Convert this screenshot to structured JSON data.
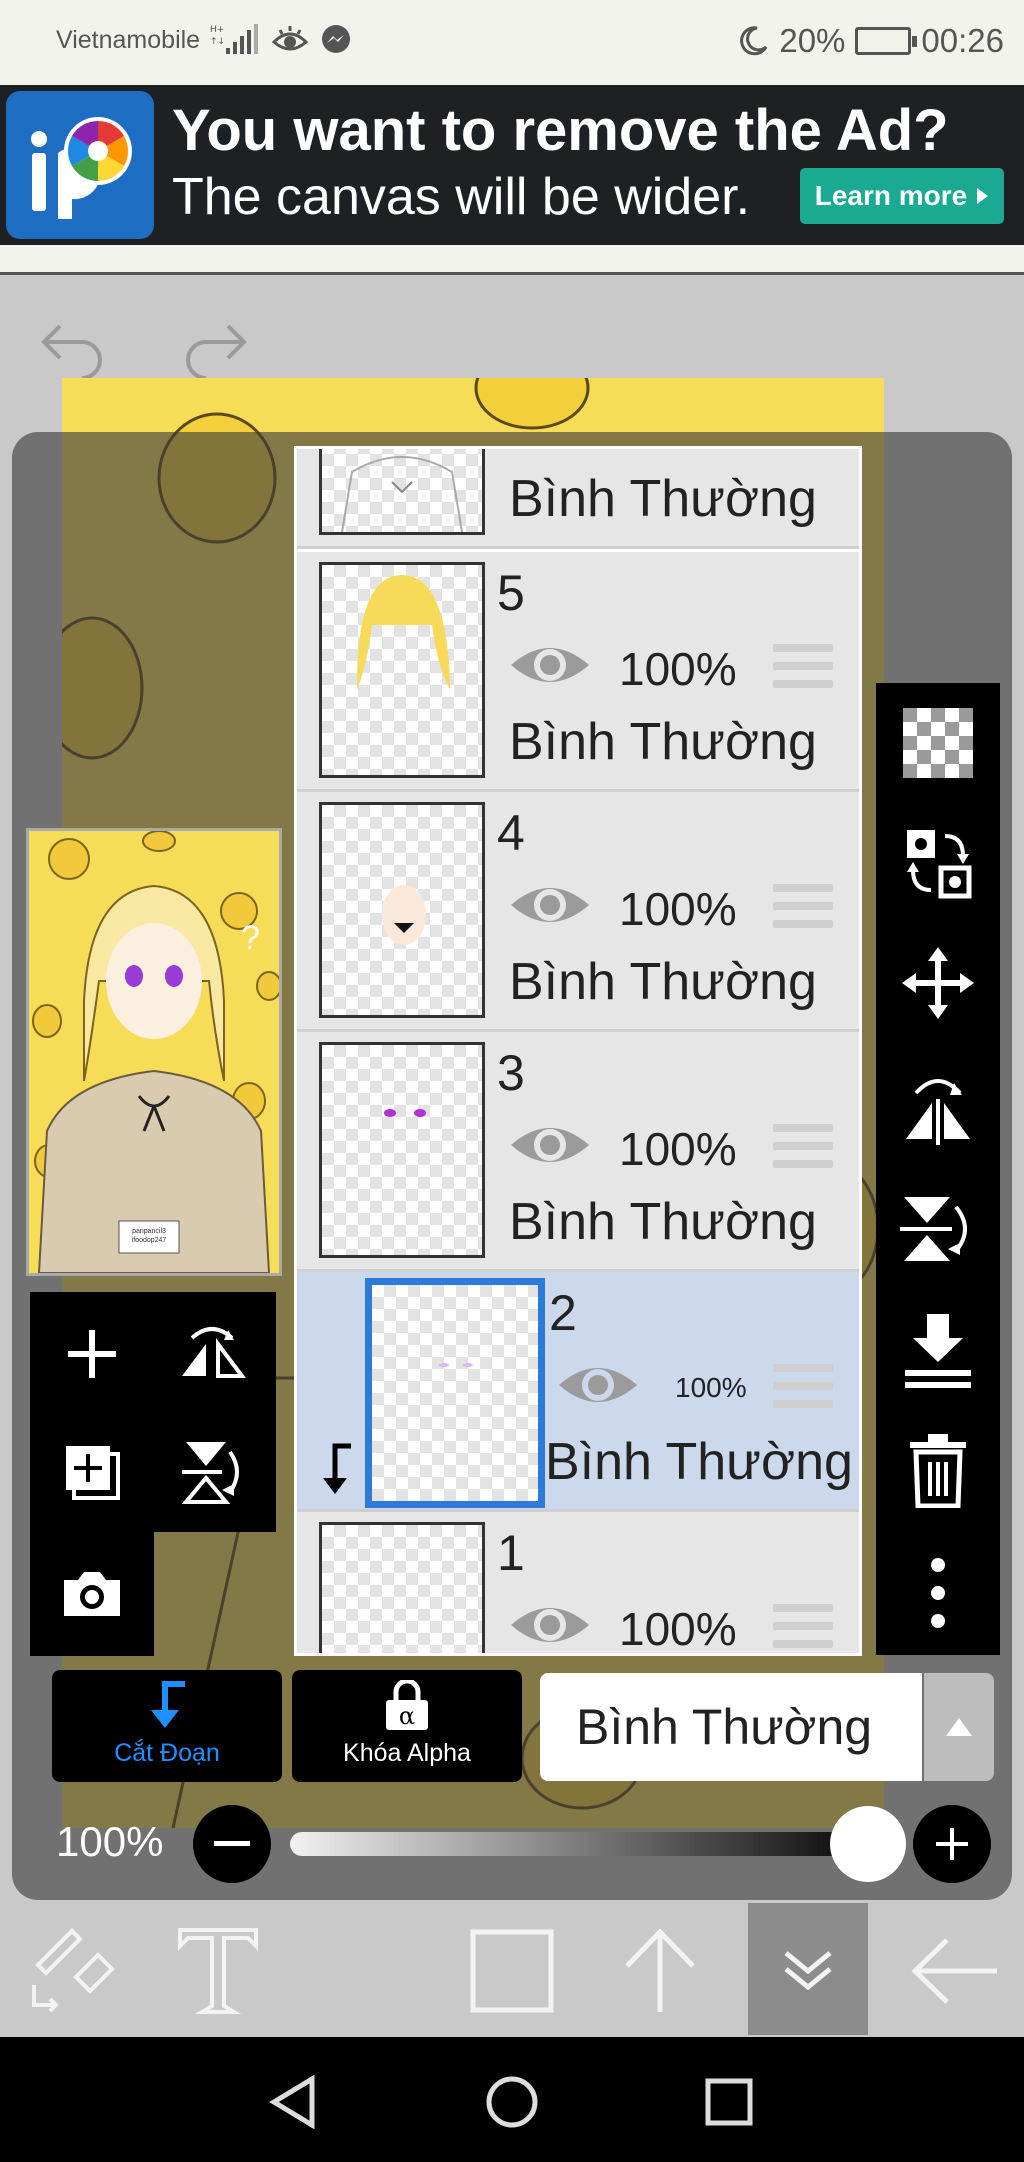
{
  "status_bar": {
    "carrier": "Vietnamobile",
    "battery": "20%",
    "time": "00:26",
    "icons": [
      "signal-icon",
      "eye-icon",
      "messenger-icon",
      "moon-icon",
      "battery-icon"
    ]
  },
  "ad": {
    "title": "You want to remove the Ad?",
    "subtitle": "The canvas will be wider.",
    "button": "Learn more",
    "logo": "ibis-paint-logo"
  },
  "layers": [
    {
      "number": "",
      "opacity": "",
      "mode": "Bình Thường",
      "partial": true
    },
    {
      "number": "5",
      "opacity": "100%",
      "mode": "Bình Thường"
    },
    {
      "number": "4",
      "opacity": "100%",
      "mode": "Bình Thường"
    },
    {
      "number": "3",
      "opacity": "100%",
      "mode": "Bình Thường"
    },
    {
      "number": "2",
      "opacity": "100%",
      "mode": "Bình Thường",
      "selected": true,
      "clipped": true
    },
    {
      "number": "1",
      "opacity": "100%",
      "mode": "",
      "partial": true
    }
  ],
  "controls": {
    "clip_label": "Cắt Đoạn",
    "alpha_lock_label": "Khóa Alpha",
    "blend_mode": "Bình Thường",
    "opacity_label": "100%",
    "opacity_value": 1.0
  },
  "thumbnail_tag": "panpancil3 ifoodop247",
  "thumbnail_question": "?",
  "colors": {
    "accent": "#2d7ad8",
    "selected_layer": "#ccd8ec",
    "canvas_bg": "#f7dc58",
    "ad_button": "#1aaa93"
  }
}
